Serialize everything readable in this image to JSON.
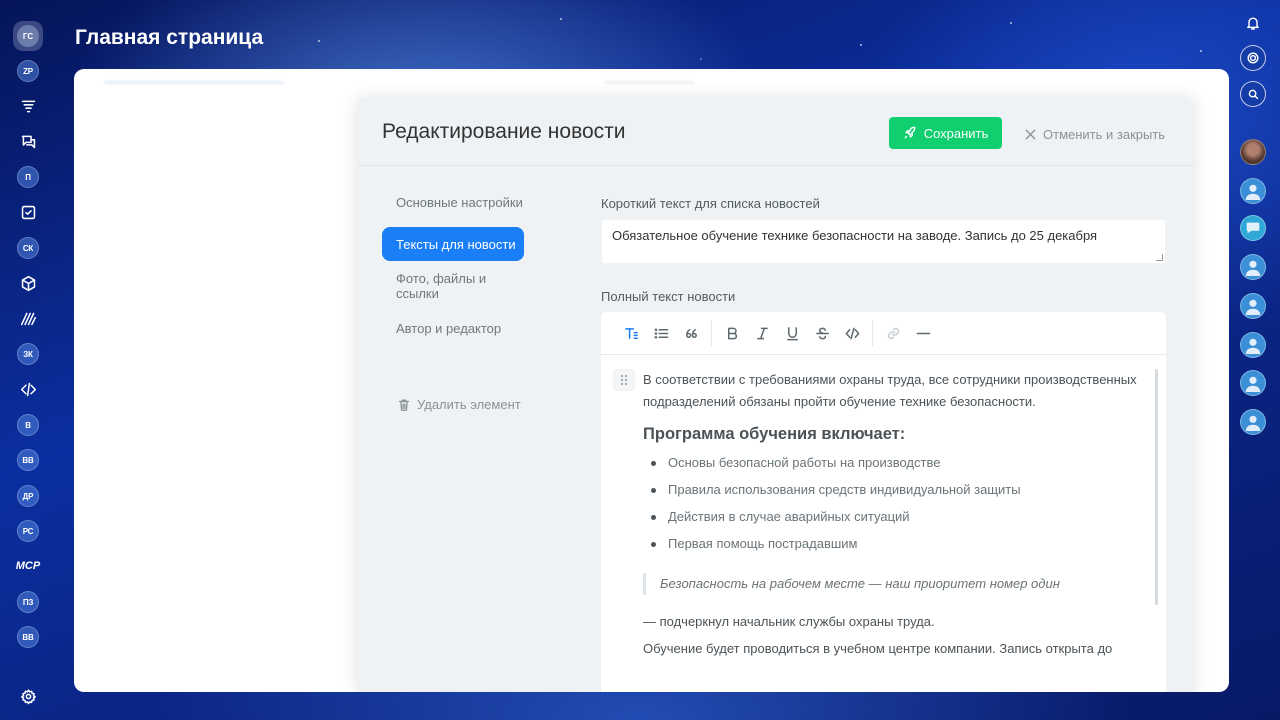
{
  "window": {
    "title": "Главная страница"
  },
  "left_rail": {
    "items": [
      {
        "label": "ГС",
        "kind": "avatar-active"
      },
      {
        "label": "ZP",
        "kind": "avatar"
      },
      {
        "icon": "funnel-icon"
      },
      {
        "icon": "chats-icon"
      },
      {
        "label": "П",
        "kind": "avatar"
      },
      {
        "icon": "tasks-check-icon"
      },
      {
        "label": "СК",
        "kind": "avatar"
      },
      {
        "icon": "box-icon"
      },
      {
        "icon": "brand-lines-icon"
      },
      {
        "label": "ЗК",
        "kind": "avatar"
      },
      {
        "icon": "code-icon"
      },
      {
        "label": "В",
        "kind": "avatar"
      },
      {
        "label": "ВВ",
        "kind": "avatar"
      },
      {
        "label": "ДР",
        "kind": "avatar"
      },
      {
        "label": "РС",
        "kind": "avatar"
      },
      {
        "label": "МСР",
        "kind": "text"
      },
      {
        "label": "ПЗ",
        "kind": "avatar"
      },
      {
        "label": "ВВ",
        "kind": "avatar"
      }
    ],
    "settings_icon": "gear-icon"
  },
  "right_rail": {
    "icons": [
      "bell-icon",
      "target-icon",
      "search-chat-icon"
    ],
    "avatars": [
      "user-photo",
      "user-default",
      "chat",
      "user-default",
      "user-default",
      "user-default",
      "user-default",
      "user-default"
    ]
  },
  "dialog": {
    "title": "Редактирование новости",
    "save_label": "Сохранить",
    "cancel_label": "Отменить и закрыть",
    "nav": [
      {
        "label": "Основные настройки",
        "active": false
      },
      {
        "label": "Тексты для новости",
        "active": true
      },
      {
        "label": "Фото, файлы и ссылки",
        "active": false
      },
      {
        "label": "Автор и редактор",
        "active": false
      }
    ],
    "delete_label": "Удалить элемент",
    "short_text_label": "Короткий текст для списка новостей",
    "short_text_value": "Обязательное обучение технике безопасности на заводе. Запись до 25 декабря",
    "full_text_label": "Полный текст новости",
    "toolbar": [
      "text-format-icon",
      "bullet-list-icon",
      "quote-icon",
      "bold-icon",
      "italic-icon",
      "underline-icon",
      "strikethrough-icon",
      "code-icon",
      "link-icon",
      "horizontal-rule-icon"
    ],
    "content": {
      "intro": "В соответствии с требованиями охраны труда, все сотрудники производственных подразделений обязаны пройти обучение технике безопасности.",
      "heading": "Программа обучения включает:",
      "list": [
        "Основы безопасной работы на производстве",
        "Правила использования средств индивидуальной защиты",
        "Действия в случае аварийных ситуаций",
        "Первая помощь пострадавшим"
      ],
      "quote": "Безопасность на рабочем месте — наш приоритет номер один",
      "after_quote": "— подчеркнул начальник службы охраны труда.",
      "last_line": "Обучение будет проводиться в учебном центре компании. Запись открыта до"
    }
  },
  "colors": {
    "accent": "#1a7ef7",
    "save": "#0fcf6f",
    "dialog_bg": "#eef2f4"
  }
}
